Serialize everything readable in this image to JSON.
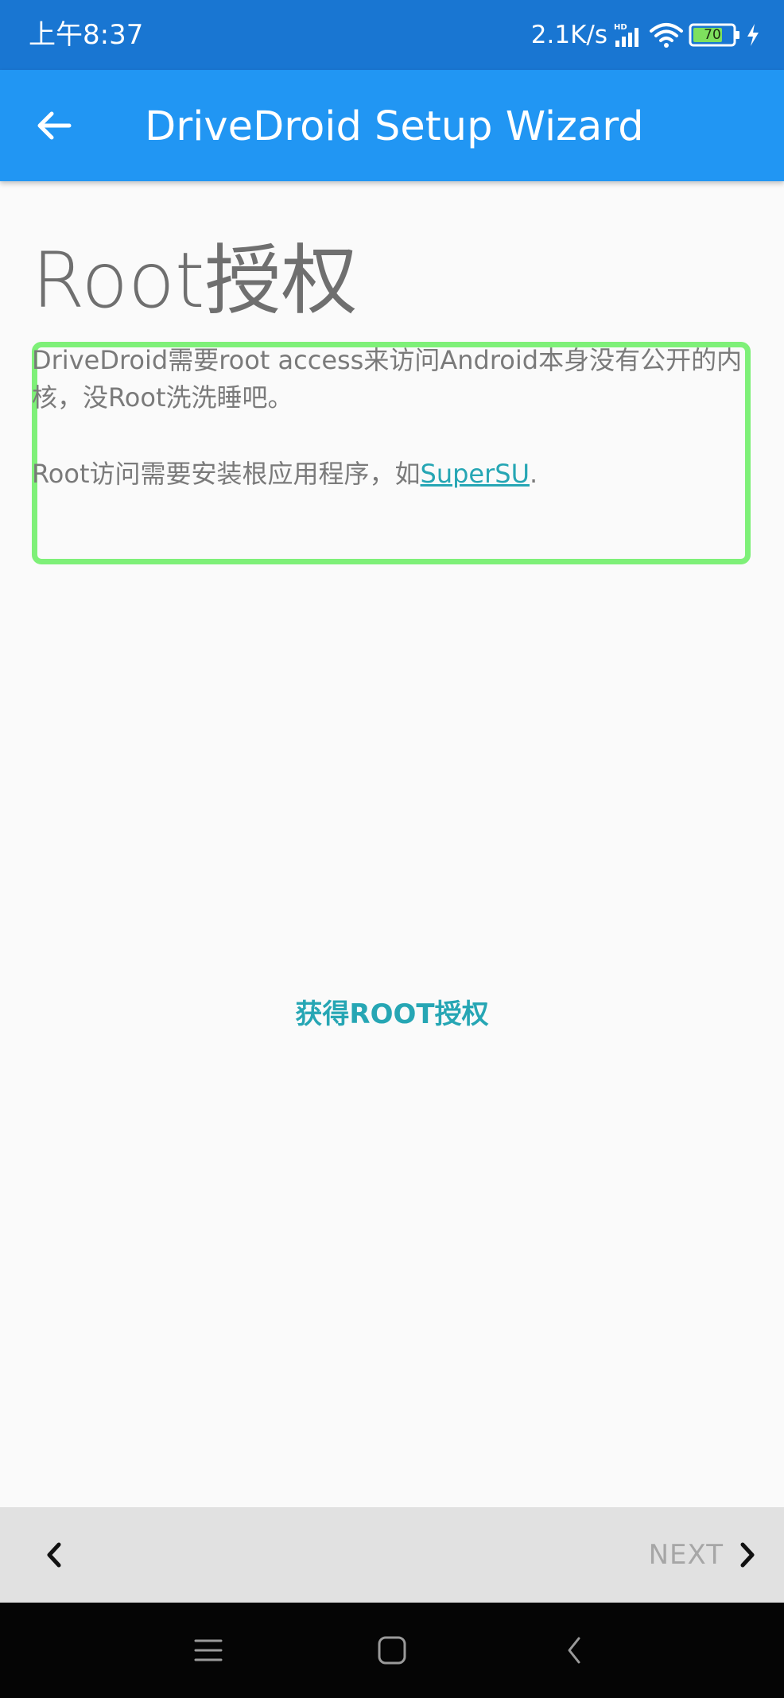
{
  "status_bar": {
    "time": "上午8:37",
    "net_speed": "2.1K/s",
    "battery": "70",
    "icons": [
      "hd-signal-icon",
      "wifi-icon",
      "battery-icon",
      "charging-icon"
    ]
  },
  "app_bar": {
    "back_icon": "arrow-left-icon",
    "title": "DriveDroid Setup Wizard"
  },
  "content": {
    "title": "Root授权",
    "paragraph1": "DriveDroid需要root access来访问Android本身没有公开的内核，没Root洗洗睡吧。",
    "paragraph2_prefix": "Root访问需要安装根应用程序，如",
    "link_label": "SuperSU",
    "paragraph2_suffix": ".",
    "grant_button": "获得ROOT授权"
  },
  "wizard_nav": {
    "prev_icon": "chevron-left-icon",
    "next_label": "NEXT",
    "next_icon": "chevron-right-icon"
  },
  "system_nav": {
    "icons": [
      "menu-icon",
      "home-icon",
      "back-icon"
    ]
  },
  "colors": {
    "status_bar": "#1976d2",
    "app_bar": "#2196f3",
    "accent": "#26a6b4",
    "highlight": "#7ef078",
    "background": "#fafafa",
    "nav_bar": "#e1e1e1"
  }
}
